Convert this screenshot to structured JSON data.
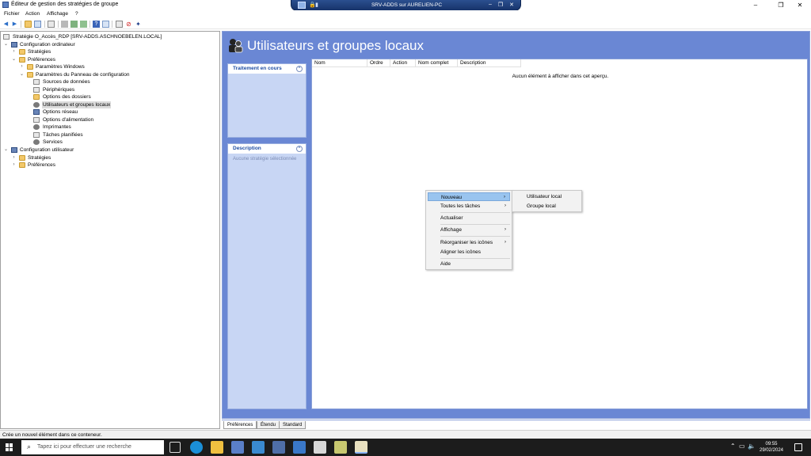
{
  "window": {
    "title": "Éditeur de gestion des stratégies de groupe",
    "controls": [
      "–",
      "❐",
      "✕"
    ]
  },
  "rdp_bar": {
    "title": "SRV-ADDS sur AURELIEN-PC",
    "buttons": [
      "–",
      "❐",
      "✕"
    ]
  },
  "menu": [
    "Fichier",
    "Action",
    "Affichage",
    "?"
  ],
  "tree": {
    "root": "Stratégie O_Accès_RDP [SRV-ADDS.ASCHNOEBELEN.LOCAL]",
    "items": [
      {
        "label": "Configuration ordinateur",
        "expander": "⌄"
      },
      {
        "label": "Stratégies",
        "expander": "›"
      },
      {
        "label": "Préférences",
        "expander": "⌄"
      },
      {
        "label": "Paramètres Windows",
        "expander": "›"
      },
      {
        "label": "Paramètres du Panneau de configuration",
        "expander": "⌄"
      },
      {
        "label": "Sources de données"
      },
      {
        "label": "Périphériques"
      },
      {
        "label": "Options des dossiers"
      },
      {
        "label": "Utilisateurs et groupes locaux",
        "selected": true
      },
      {
        "label": "Options réseau"
      },
      {
        "label": "Options d'alimentation"
      },
      {
        "label": "Imprimantes"
      },
      {
        "label": "Tâches planifiées"
      },
      {
        "label": "Services"
      },
      {
        "label": "Configuration utilisateur",
        "expander": "⌄"
      },
      {
        "label": "Stratégies",
        "expander": "›"
      },
      {
        "label": "Préférences",
        "expander": "›"
      }
    ]
  },
  "details": {
    "title": "Utilisateurs et groupes locaux",
    "panel_processing": {
      "title": "Traitement en cours"
    },
    "panel_description": {
      "title": "Description",
      "text": "Aucune stratégie sélectionnée"
    },
    "columns": [
      "Nom",
      "Ordre",
      "Action",
      "Nom complet",
      "Description"
    ],
    "empty_message": "Aucun élément à afficher dans cet aperçu."
  },
  "context_menu": {
    "items": [
      {
        "label": "Nouveau",
        "submenu": true,
        "highlighted": true
      },
      {
        "label": "Toutes les tâches",
        "submenu": true
      },
      {
        "label": "Actualiser"
      },
      {
        "label": "Affichage",
        "submenu": true
      },
      {
        "label": "Réorganiser les icônes",
        "submenu": true
      },
      {
        "label": "Aligner les icônes"
      },
      {
        "label": "Aide"
      }
    ],
    "submenu_new": [
      "Utilisateur local",
      "Groupe local"
    ]
  },
  "tabs": [
    "Préférences",
    "Étendu",
    "Standard"
  ],
  "status_text": "Crée un nouvel élément dans ce conteneur.",
  "taskbar": {
    "search_placeholder": "Tapez ici pour effectuer une recherche",
    "time": "09:55",
    "date": "29/02/2024"
  },
  "colors": {
    "pane_blue": "#6a87d4",
    "panel_blue": "#c8d6f4",
    "menu_highlight": "#99c4ef",
    "taskbar": "#1c1c1c"
  }
}
